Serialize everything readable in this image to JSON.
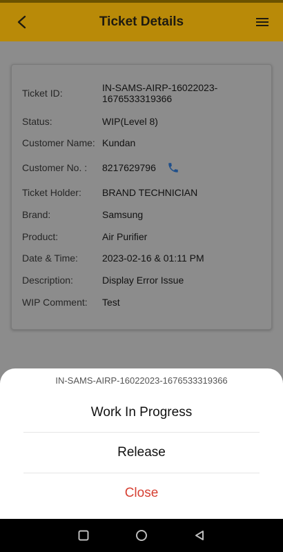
{
  "header": {
    "title": "Ticket Details",
    "back_icon": "back-chevron-icon",
    "menu_icon": "hamburger-menu-icon"
  },
  "details": [
    {
      "key": "ticket_id",
      "label": "Ticket ID:",
      "value": "IN-SAMS-AIRP-16022023-1676533319366"
    },
    {
      "key": "status",
      "label": "Status:",
      "value": "WIP(Level 8)"
    },
    {
      "key": "customer_name",
      "label": "Customer Name:",
      "value": "Kundan"
    },
    {
      "key": "customer_no",
      "label": "Customer No. :",
      "value": "8217629796"
    },
    {
      "key": "ticket_holder",
      "label": "Ticket Holder:",
      "value": "BRAND TECHNICIAN"
    },
    {
      "key": "brand",
      "label": "Brand:",
      "value": "Samsung"
    },
    {
      "key": "product",
      "label": "Product:",
      "value": "Air Purifier"
    },
    {
      "key": "date_time",
      "label": "Date & Time:",
      "value": "2023-02-16 & 01:11 PM"
    },
    {
      "key": "description",
      "label": "Description:",
      "value": "Display Error Issue"
    },
    {
      "key": "wip_comment",
      "label": "WIP Comment:",
      "value": "Test"
    }
  ],
  "sheet": {
    "title": "IN-SAMS-AIRP-16022023-1676533319366",
    "work_in_progress_label": "Work In Progress",
    "release_label": "Release",
    "close_label": "Close"
  },
  "colors": {
    "app_bar": "#b98a08",
    "phone_icon": "#1f4f8a",
    "close_text": "#d64033"
  },
  "nav": {
    "recent_icon": "recent-apps-square-icon",
    "home_icon": "home-circle-icon",
    "back_icon": "back-triangle-icon"
  }
}
